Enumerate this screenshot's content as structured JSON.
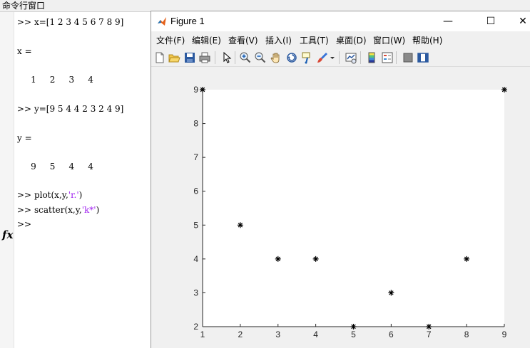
{
  "command_window": {
    "title": "命令行窗口",
    "lines": [
      {
        "prompt": ">>",
        "code": "x=[1 2 3 4 5 6 7 8 9]"
      },
      {
        "output": "x ="
      },
      {
        "output": "     1     2     3     4"
      },
      {
        "prompt": ">>",
        "code": "y=[9 5 4 4 2 3 2 4 9]"
      },
      {
        "output": "y ="
      },
      {
        "output": "     9     5     4     4"
      },
      {
        "prompt": ">>",
        "code_pre": "plot(x,y,",
        "code_str": "'r.'",
        "code_post": ")"
      },
      {
        "prompt": ">>",
        "code_pre": "scatter(x,y,",
        "code_str": "'k*'",
        "code_post": ")"
      },
      {
        "prompt": ">>"
      }
    ],
    "fx_label": "fx"
  },
  "figure": {
    "title": "Figure 1",
    "window_buttons": {
      "minimize": "—",
      "maximize": "☐",
      "close": "✕"
    },
    "menu": [
      "文件(F)",
      "编辑(E)",
      "查看(V)",
      "插入(I)",
      "工具(T)",
      "桌面(D)",
      "窗口(W)",
      "帮助(H)"
    ],
    "toolbar_icons": [
      "new-figure-icon",
      "open-file-icon",
      "save-icon",
      "print-icon",
      "edit-plot-arrow-icon",
      "zoom-in-icon",
      "zoom-out-icon",
      "pan-hand-icon",
      "rotate-3d-icon",
      "data-cursor-icon",
      "brush-icon",
      "brush-dropdown-icon",
      "link-plot-icon",
      "insert-colorbar-icon",
      "insert-legend-icon",
      "hide-plot-tools-icon",
      "show-plot-tools-icon"
    ]
  },
  "chart_data": {
    "type": "scatter",
    "title": "",
    "xlabel": "",
    "ylabel": "",
    "xlim": [
      1,
      9
    ],
    "ylim": [
      2,
      9
    ],
    "xticks": [
      1,
      2,
      3,
      4,
      5,
      6,
      7,
      8,
      9
    ],
    "yticks": [
      2,
      3,
      4,
      5,
      6,
      7,
      8,
      9
    ],
    "marker": "*",
    "marker_color": "#000000",
    "grid": false,
    "series": [
      {
        "x": [
          1,
          2,
          3,
          4,
          5,
          6,
          7,
          8,
          9
        ],
        "y": [
          9,
          5,
          4,
          4,
          2,
          3,
          2,
          4,
          9
        ]
      }
    ]
  }
}
